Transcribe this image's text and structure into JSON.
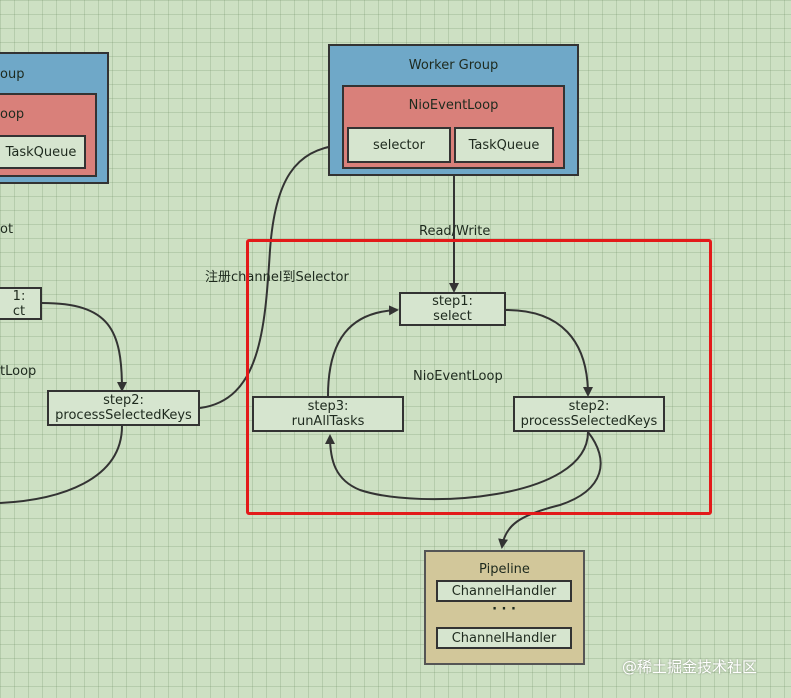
{
  "left_partial": {
    "group_label": "oup",
    "loop_label": "oop",
    "taskqueue": "TaskQueue",
    "side_text_1": "ot",
    "step1_line1": "1:",
    "step1_line2": "ct",
    "side_text_2": "tLoop",
    "step2_line1": "step2:",
    "step2_line2": "processSelectedKeys"
  },
  "register_label": "注册channel到Selector",
  "worker_group": {
    "title": "Worker Group",
    "event_loop": "NioEventLoop",
    "selector": "selector",
    "taskqueue": "TaskQueue"
  },
  "read_write_label": "Read/Write",
  "event_loop_center": "NioEventLoop",
  "steps": {
    "step1_line1": "step1:",
    "step1_line2": "select",
    "step2_line1": "step2:",
    "step2_line2": "processSelectedKeys",
    "step3_line1": "step3:",
    "step3_line2": "runAllTasks"
  },
  "pipeline": {
    "title": "Pipeline",
    "handler_1": "ChannelHandler",
    "dots": "· · ·",
    "handler_2": "ChannelHandler"
  },
  "watermark": "@稀土掘金技术社区",
  "colors": {
    "background": "#cde0c3",
    "worker_group": "#6fa8c8",
    "event_loop": "#d9807a",
    "step_box": "#d6e5cf",
    "pipeline": "#d2c79a",
    "highlight": "#e31a1a"
  }
}
